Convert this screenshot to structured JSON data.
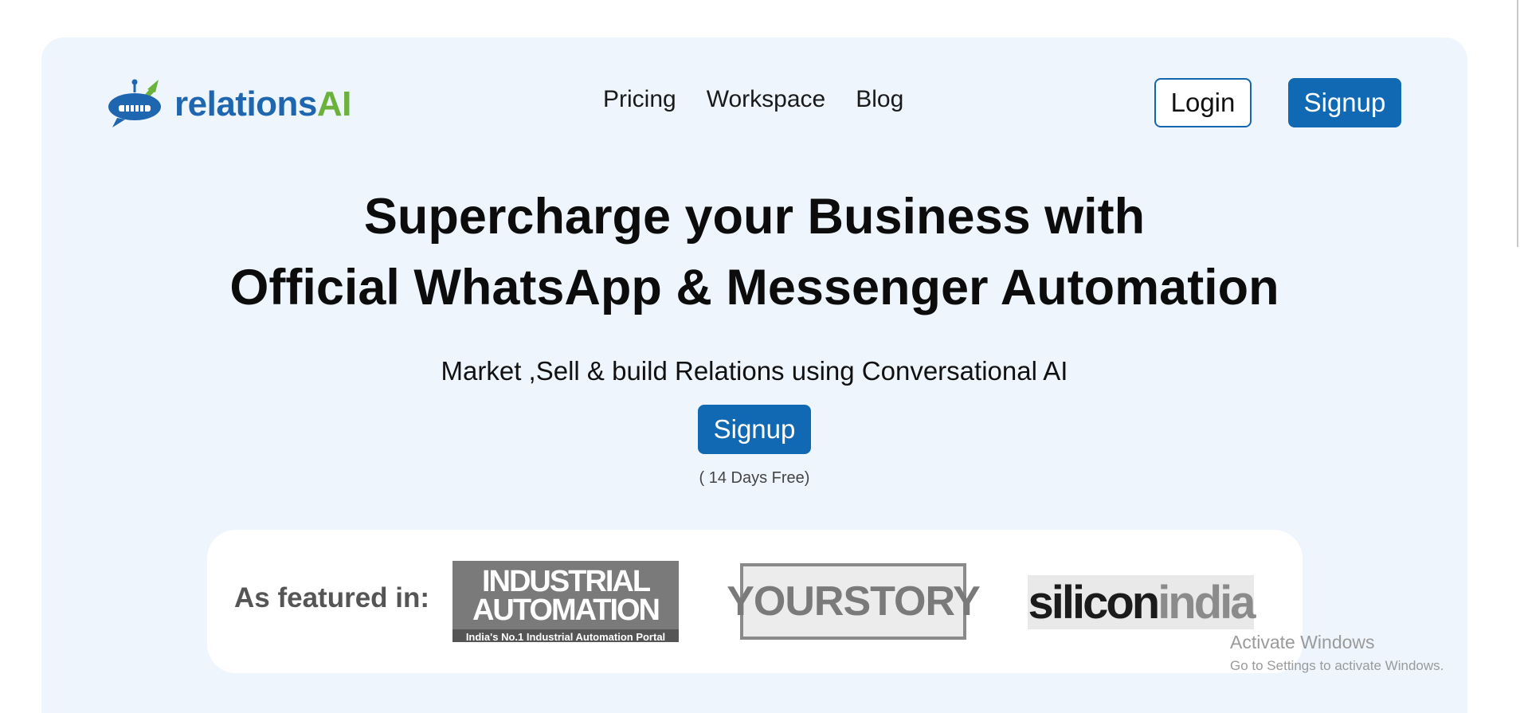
{
  "brand": {
    "name_main": "relations",
    "name_accent": "AI",
    "logo_icon": "rocket-robot-logo-icon",
    "colors": {
      "primary": "#1269b3",
      "accent": "#6ab23c",
      "hero_bg": "#eef5fc"
    }
  },
  "nav": {
    "items": [
      {
        "label": "Pricing"
      },
      {
        "label": "Workspace"
      },
      {
        "label": "Blog"
      }
    ],
    "login_label": "Login",
    "signup_label": "Signup"
  },
  "hero": {
    "headline_line1": "Supercharge your Business with",
    "headline_line2": "Official WhatsApp & Messenger Automation",
    "subheadline": "Market ,Sell & build Relations using Conversational AI",
    "cta_label": "Signup",
    "trial_note": "( 14 Days Free)"
  },
  "featured": {
    "label": "As featured in:",
    "logos": [
      {
        "line1": "INDUSTRIAL",
        "line2": "AUTOMATION",
        "tagline": "India's No.1 Industrial Automation Portal"
      },
      {
        "text": "YOURSTORY"
      },
      {
        "text_dark": "silicon",
        "text_light": "india"
      }
    ]
  },
  "os_watermark": {
    "title": "Activate Windows",
    "subtitle": "Go to Settings to activate Windows."
  }
}
